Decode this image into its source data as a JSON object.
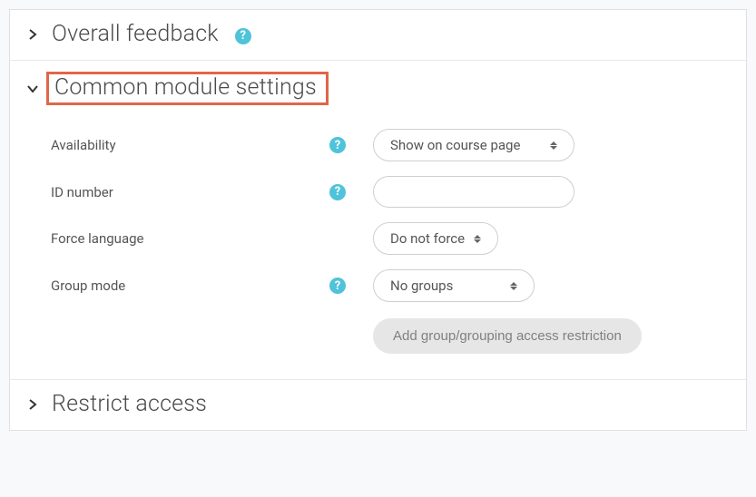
{
  "sections": {
    "overall_feedback": {
      "title": "Overall feedback",
      "expanded": false,
      "has_help": true
    },
    "common_module": {
      "title": "Common module settings",
      "expanded": true,
      "highlighted": true,
      "fields": {
        "availability": {
          "label": "Availability",
          "has_help": true,
          "value": "Show on course page"
        },
        "id_number": {
          "label": "ID number",
          "has_help": true,
          "value": ""
        },
        "force_language": {
          "label": "Force language",
          "has_help": false,
          "value": "Do not force"
        },
        "group_mode": {
          "label": "Group mode",
          "has_help": true,
          "value": "No groups"
        }
      },
      "group_restriction_button": "Add group/grouping access restriction"
    },
    "restrict_access": {
      "title": "Restrict access",
      "expanded": false
    }
  }
}
